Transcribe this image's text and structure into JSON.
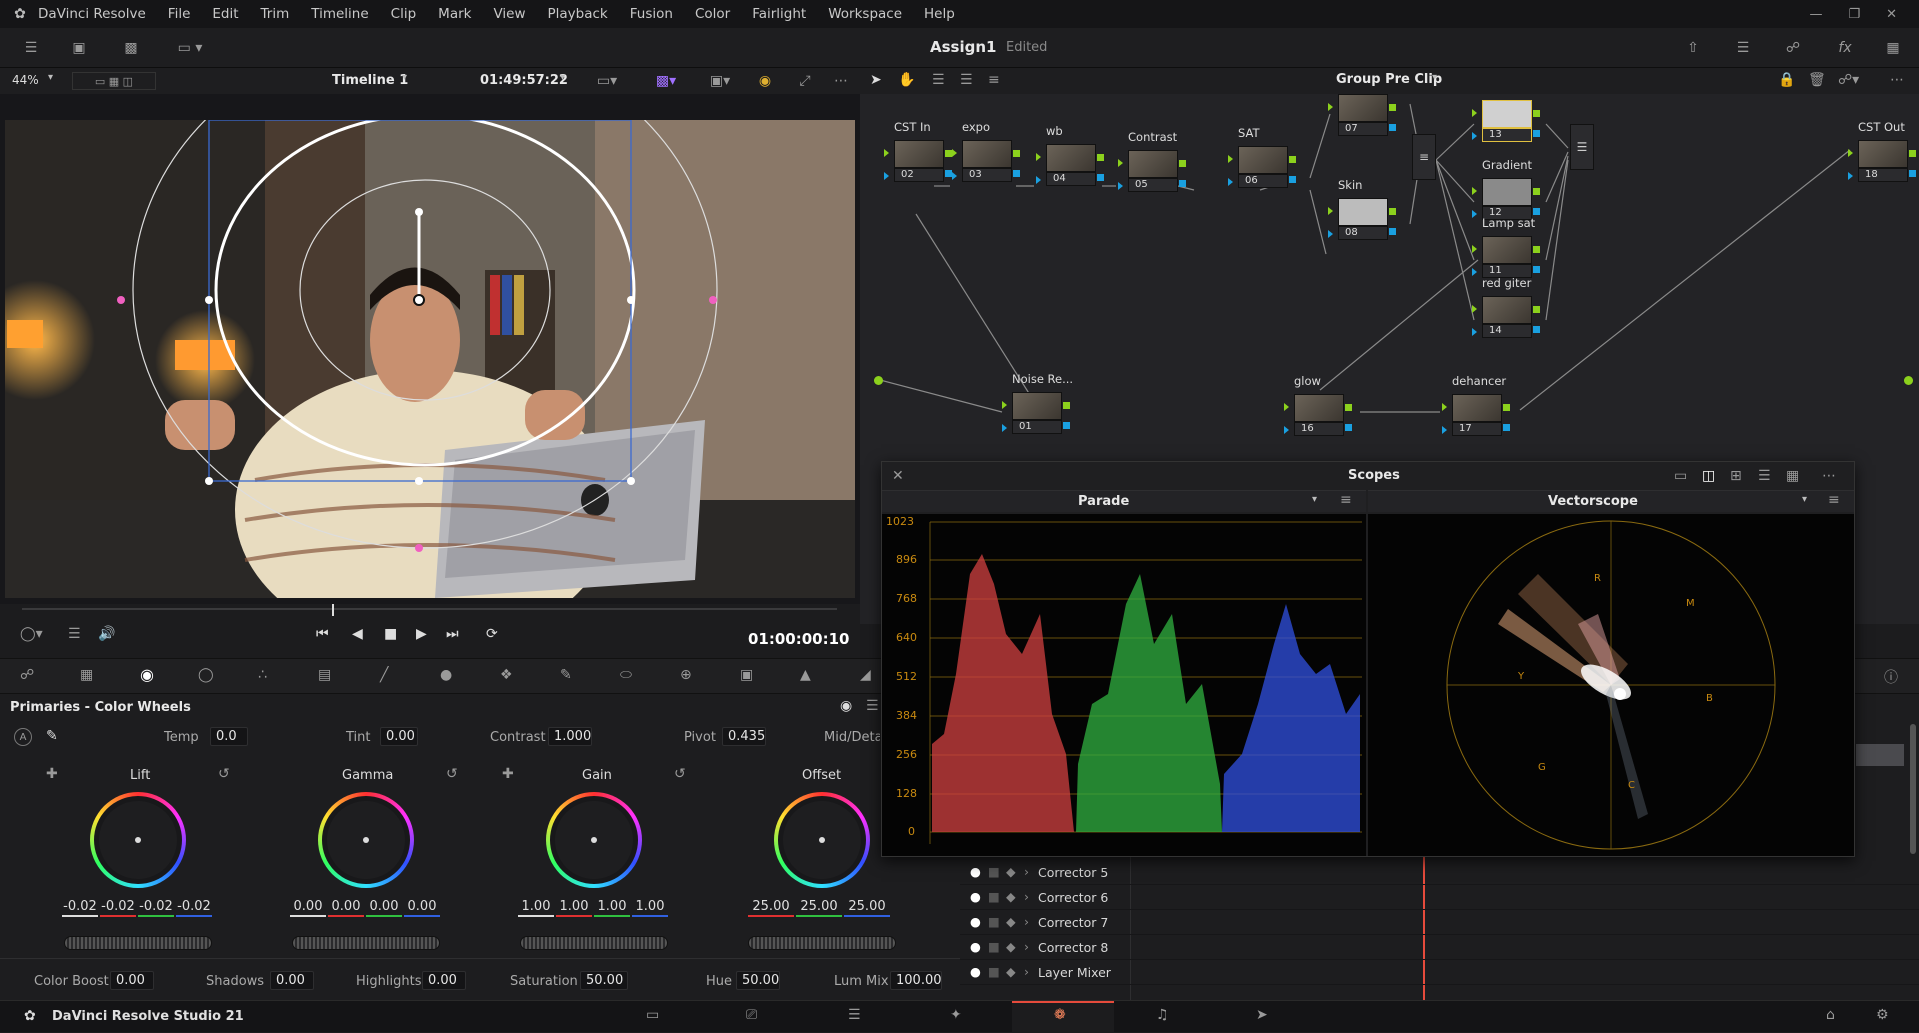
{
  "menubar": {
    "app": "DaVinci Resolve",
    "items": [
      "File",
      "Edit",
      "Trim",
      "Timeline",
      "Clip",
      "Mark",
      "View",
      "Playback",
      "Fusion",
      "Color",
      "Fairlight",
      "Workspace",
      "Help"
    ]
  },
  "header": {
    "project": "Assign1",
    "status": "Edited"
  },
  "viewer": {
    "zoom": "44%",
    "timeline": "Timeline 1",
    "timecode": "01:49:57:22",
    "playhead_tc": "01:00:00:10"
  },
  "nodes": {
    "mode": "Group Pre Clip",
    "items": [
      {
        "label": "CST In",
        "num": "02"
      },
      {
        "label": "expo",
        "num": "03"
      },
      {
        "label": "wb",
        "num": "04"
      },
      {
        "label": "Contrast",
        "num": "05"
      },
      {
        "label": "SAT",
        "num": "06"
      },
      {
        "label": "",
        "num": "07"
      },
      {
        "label": "Skin",
        "num": "08"
      },
      {
        "label": "",
        "num": "13"
      },
      {
        "label": "Gradient",
        "num": "12"
      },
      {
        "label": "Lamp sat",
        "num": "11"
      },
      {
        "label": "red giter",
        "num": "14"
      },
      {
        "label": "CST Out",
        "num": "18"
      },
      {
        "label": "Noise Re...",
        "num": "01"
      },
      {
        "label": "glow",
        "num": "16"
      },
      {
        "label": "dehancer",
        "num": "17"
      }
    ]
  },
  "scopes": {
    "title": "Scopes",
    "left": "Parade",
    "right": "Vectorscope",
    "parade_ticks": [
      "1023",
      "896",
      "768",
      "640",
      "512",
      "384",
      "256",
      "128",
      "0"
    ],
    "vector_targets": [
      "R",
      "M",
      "B",
      "C",
      "G",
      "Y"
    ]
  },
  "primaries": {
    "title": "Primaries - Color Wheels",
    "temp_label": "Temp",
    "temp": "0.0",
    "tint_label": "Tint",
    "tint": "0.00",
    "contrast_label": "Contrast",
    "contrast": "1.000",
    "pivot_label": "Pivot",
    "pivot": "0.435",
    "middetail_label": "Mid/Detail",
    "wheels": [
      {
        "name": "Lift",
        "values": [
          "-0.02",
          "-0.02",
          "-0.02",
          "-0.02"
        ]
      },
      {
        "name": "Gamma",
        "values": [
          "0.00",
          "0.00",
          "0.00",
          "0.00"
        ]
      },
      {
        "name": "Gain",
        "values": [
          "1.00",
          "1.00",
          "1.00",
          "1.00"
        ]
      },
      {
        "name": "Offset",
        "values": [
          "25.00",
          "25.00",
          "25.00"
        ]
      }
    ],
    "colorboost_label": "Color Boost",
    "colorboost": "0.00",
    "shadows_label": "Shadows",
    "shadows": "0.00",
    "highlights_label": "Highlights",
    "highlights": "0.00",
    "saturation_label": "Saturation",
    "saturation": "50.00",
    "hue_label": "Hue",
    "hue": "50.00",
    "lummix_label": "Lum Mix",
    "lummix": "100.00"
  },
  "layers": {
    "items": [
      "Corrector 5",
      "Corrector 6",
      "Corrector 7",
      "Corrector 8",
      "Layer Mixer"
    ]
  },
  "footer": {
    "app": "DaVinci Resolve Studio 21"
  },
  "colors": {
    "accent": "#e64b3c",
    "node_pin": "#8cd11d",
    "pin_blue": "#1aa0e0",
    "scope_grid": "#b8860b"
  }
}
